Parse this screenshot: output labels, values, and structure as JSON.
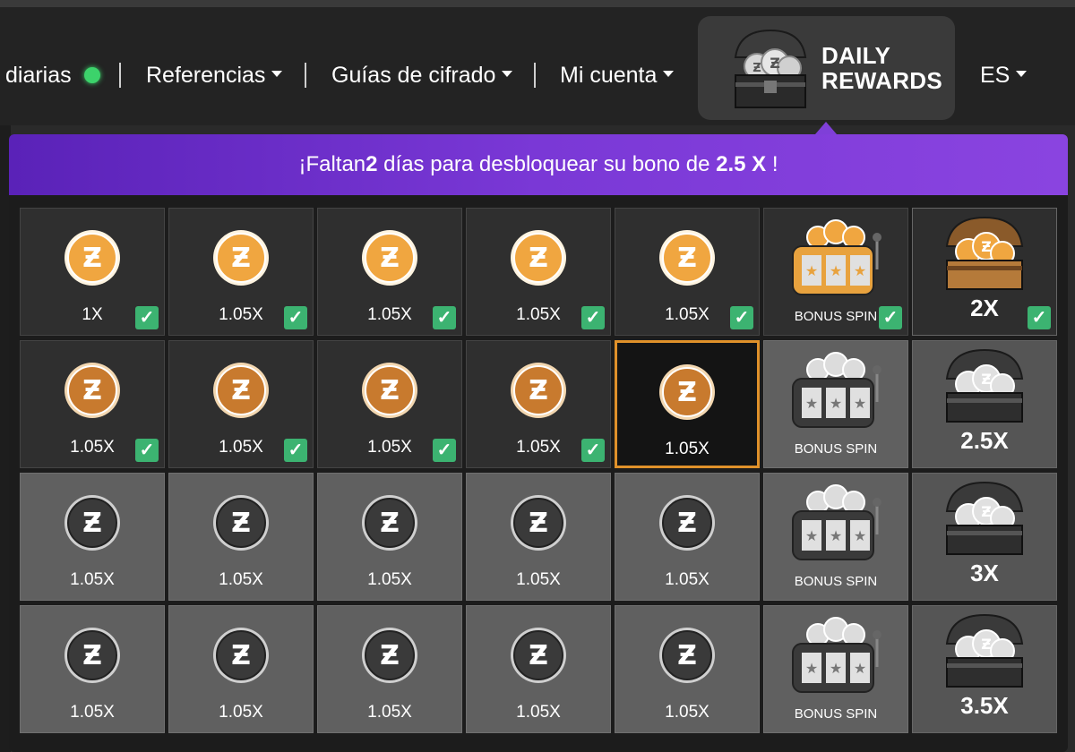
{
  "nav": {
    "items": [
      {
        "label": "diarias",
        "caret": false,
        "dot": true
      },
      {
        "label": "Referencias",
        "caret": true
      },
      {
        "label": "Guías de cifrado",
        "caret": true
      },
      {
        "label": "Mi cuenta",
        "caret": true
      }
    ],
    "rewards_line1": "DAILY",
    "rewards_line2": "REWARDS",
    "lang": "ES"
  },
  "banner": {
    "prefix": "¡Faltan ",
    "days": "2",
    "middle": " días para desbloquear su bono de ",
    "bonus": "2.5 X",
    "suffix": " !"
  },
  "rows": [
    [
      {
        "kind": "coin",
        "label": "1X",
        "state": "claimed",
        "checked": true
      },
      {
        "kind": "coin",
        "label": "1.05X",
        "state": "claimed",
        "checked": true
      },
      {
        "kind": "coin",
        "label": "1.05X",
        "state": "claimed",
        "checked": true
      },
      {
        "kind": "coin",
        "label": "1.05X",
        "state": "claimed",
        "checked": true
      },
      {
        "kind": "coin",
        "label": "1.05X",
        "state": "claimed",
        "checked": true
      },
      {
        "kind": "spin",
        "label": "BONUS SPIN",
        "state": "claimed",
        "checked": true
      },
      {
        "kind": "chest",
        "label": "2X",
        "state": "claimed",
        "checked": true
      }
    ],
    [
      {
        "kind": "coin",
        "label": "1.05X",
        "state": "claimed",
        "checked": true
      },
      {
        "kind": "coin",
        "label": "1.05X",
        "state": "claimed",
        "checked": true
      },
      {
        "kind": "coin",
        "label": "1.05X",
        "state": "claimed",
        "checked": true
      },
      {
        "kind": "coin",
        "label": "1.05X",
        "state": "claimed",
        "checked": true
      },
      {
        "kind": "coin",
        "label": "1.05X",
        "state": "today",
        "checked": false
      },
      {
        "kind": "spin",
        "label": "BONUS SPIN",
        "state": "locked",
        "checked": false
      },
      {
        "kind": "chest",
        "label": "2.5X",
        "state": "locked",
        "checked": false
      }
    ],
    [
      {
        "kind": "coin",
        "label": "1.05X",
        "state": "locked",
        "checked": false
      },
      {
        "kind": "coin",
        "label": "1.05X",
        "state": "locked",
        "checked": false
      },
      {
        "kind": "coin",
        "label": "1.05X",
        "state": "locked",
        "checked": false
      },
      {
        "kind": "coin",
        "label": "1.05X",
        "state": "locked",
        "checked": false
      },
      {
        "kind": "coin",
        "label": "1.05X",
        "state": "locked",
        "checked": false
      },
      {
        "kind": "spin",
        "label": "BONUS SPIN",
        "state": "locked",
        "checked": false
      },
      {
        "kind": "chest",
        "label": "3X",
        "state": "locked",
        "checked": false
      }
    ],
    [
      {
        "kind": "coin",
        "label": "1.05X",
        "state": "locked",
        "checked": false
      },
      {
        "kind": "coin",
        "label": "1.05X",
        "state": "locked",
        "checked": false
      },
      {
        "kind": "coin",
        "label": "1.05X",
        "state": "locked",
        "checked": false
      },
      {
        "kind": "coin",
        "label": "1.05X",
        "state": "locked",
        "checked": false
      },
      {
        "kind": "coin",
        "label": "1.05X",
        "state": "locked",
        "checked": false
      },
      {
        "kind": "spin",
        "label": "BONUS SPIN",
        "state": "locked",
        "checked": false
      },
      {
        "kind": "chest",
        "label": "3.5X",
        "state": "locked",
        "checked": false
      }
    ]
  ],
  "colors": {
    "gold": "#f0a640",
    "bronze": "#c87a2e",
    "silver": "#cfcfcf",
    "accent_purple": "#7a38d6",
    "check_green": "#3cb371",
    "today_border": "#e0912a"
  }
}
